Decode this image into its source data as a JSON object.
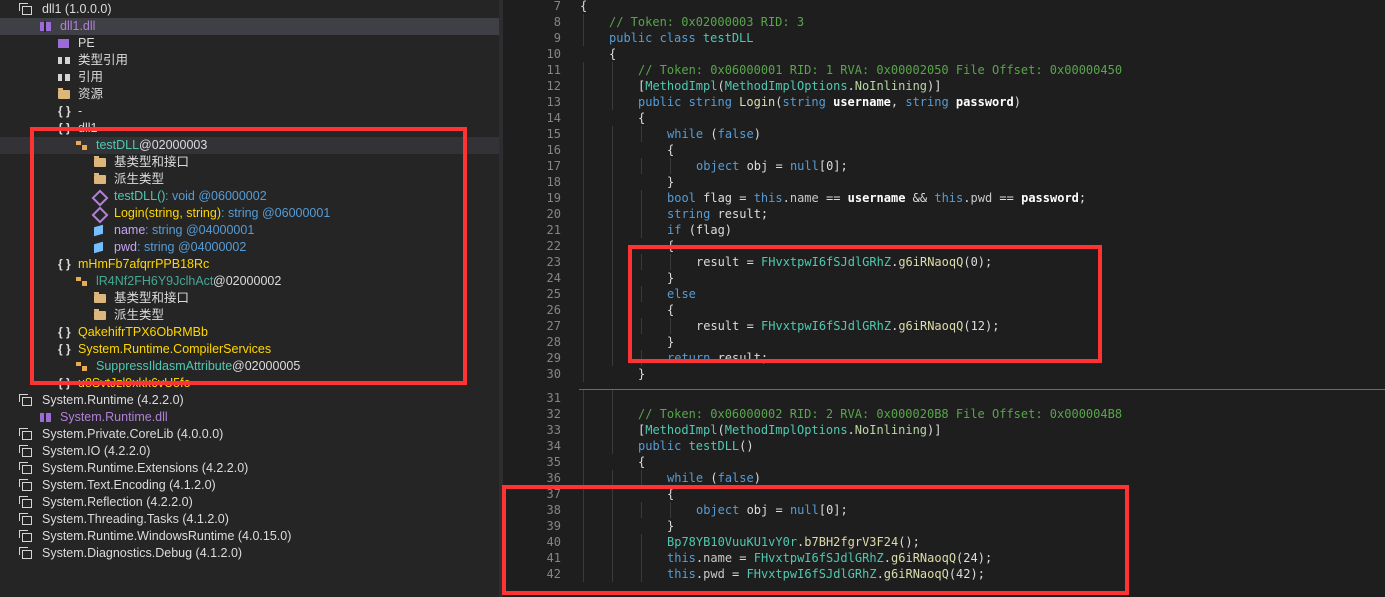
{
  "tree": {
    "rows": [
      {
        "indent": 0,
        "arrow": "◢",
        "icon": "asm",
        "icon_name": "assembly-icon",
        "text": "dll1 (1.0.0.0)",
        "cls": "c-gray",
        "sel": false
      },
      {
        "indent": 2,
        "arrow": "◢",
        "icon": "mod",
        "icon_name": "module-icon",
        "text": "dll1.dll",
        "cls": "c-lilac",
        "sel": "sel"
      },
      {
        "indent": 4,
        "arrow": "▷",
        "icon": "pe",
        "icon_name": "pe-icon",
        "text": "PE",
        "cls": "c-gray"
      },
      {
        "indent": 4,
        "arrow": "▷",
        "icon": "ref",
        "icon_name": "type-reference-icon",
        "text": "类型引用",
        "cls": "c-gray"
      },
      {
        "indent": 4,
        "arrow": "▷",
        "icon": "ref",
        "icon_name": "reference-icon",
        "text": "引用",
        "cls": "c-gray"
      },
      {
        "indent": 4,
        "arrow": "▷",
        "icon": "folder",
        "icon_name": "folder-icon",
        "text": "资源",
        "cls": "c-gray"
      },
      {
        "indent": 4,
        "arrow": "▷",
        "icon": "ns",
        "icon_name": "namespace-icon",
        "text": "-",
        "cls": "c-gray"
      },
      {
        "indent": 4,
        "arrow": "◢",
        "icon": "ns",
        "icon_name": "namespace-icon",
        "text": "dll1",
        "cls": "c-gray"
      },
      {
        "indent": 6,
        "arrow": "◢",
        "icon": "cls",
        "icon_name": "class-icon",
        "text": "testDLL",
        "suffix": " @02000003",
        "cls": "c-teal",
        "sel": "sel2"
      },
      {
        "indent": 8,
        "arrow": "▷",
        "icon": "folder",
        "icon_name": "folder-icon",
        "text": "基类型和接口",
        "cls": "c-gray"
      },
      {
        "indent": 8,
        "arrow": "",
        "icon": "folder",
        "icon_name": "folder-icon",
        "text": "派生类型",
        "cls": "c-gray"
      },
      {
        "indent": 8,
        "arrow": "",
        "icon": "meth",
        "icon_name": "method-icon",
        "text": "testDLL()",
        "suffix": " : void @06000002",
        "suffix_cls": "c-blue",
        "cls": "c-teal"
      },
      {
        "indent": 8,
        "arrow": "",
        "icon": "meth",
        "icon_name": "method-icon",
        "text": "Login(string, string)",
        "suffix": " : string @06000001",
        "suffix_cls": "c-blue",
        "cls": "c-yellow"
      },
      {
        "indent": 8,
        "arrow": "",
        "icon": "field",
        "icon_name": "field-icon",
        "text": "name",
        "suffix": " : string @04000001",
        "suffix_cls": "c-blue",
        "cls": "c-field"
      },
      {
        "indent": 8,
        "arrow": "",
        "icon": "field",
        "icon_name": "field-icon",
        "text": "pwd",
        "suffix": " : string @04000002",
        "suffix_cls": "c-blue",
        "cls": "c-field"
      },
      {
        "indent": 4,
        "arrow": "◢",
        "icon": "ns",
        "icon_name": "namespace-icon",
        "text": "mHmFb7afqrrPPB18Rc",
        "cls": "c-yellow"
      },
      {
        "indent": 6,
        "arrow": "◢",
        "icon": "cls",
        "icon_name": "class-icon",
        "text": "lR4Nf2FH6Y9JclhAct",
        "suffix": " @02000002",
        "cls": "c-dimteal"
      },
      {
        "indent": 8,
        "arrow": "▷",
        "icon": "folder",
        "icon_name": "folder-icon",
        "text": "基类型和接口",
        "cls": "c-gray"
      },
      {
        "indent": 8,
        "arrow": "",
        "icon": "folder",
        "icon_name": "folder-icon",
        "text": "派生类型",
        "cls": "c-gray"
      },
      {
        "indent": 4,
        "arrow": "▷",
        "icon": "ns",
        "icon_name": "namespace-icon",
        "text": "QakehifrTPX6ObRMBb",
        "cls": "c-yellow"
      },
      {
        "indent": 4,
        "arrow": "◢",
        "icon": "ns",
        "icon_name": "namespace-icon",
        "text": "System.Runtime.CompilerServices",
        "cls": "c-yellow"
      },
      {
        "indent": 6,
        "arrow": "▷",
        "icon": "cls",
        "icon_name": "class-icon",
        "text": "SuppressIldasmAttribute",
        "suffix": " @02000005",
        "cls": "c-teal"
      },
      {
        "indent": 4,
        "arrow": "▷",
        "icon": "ns",
        "icon_name": "namespace-icon",
        "text": "u8SvtJzl9xkk6vU5fo",
        "cls": "c-yellow"
      },
      {
        "indent": 0,
        "arrow": "◢",
        "icon": "asm",
        "icon_name": "assembly-icon",
        "text": "System.Runtime (4.2.2.0)",
        "cls": "c-gray"
      },
      {
        "indent": 2,
        "arrow": "▷",
        "icon": "mod",
        "icon_name": "module-icon",
        "text": "System.Runtime.dll",
        "cls": "c-lilac"
      },
      {
        "indent": 0,
        "arrow": "▷",
        "icon": "asm",
        "icon_name": "assembly-icon",
        "text": "System.Private.CoreLib (4.0.0.0)",
        "cls": "c-gray"
      },
      {
        "indent": 0,
        "arrow": "▷",
        "icon": "asm",
        "icon_name": "assembly-icon",
        "text": "System.IO (4.2.2.0)",
        "cls": "c-gray"
      },
      {
        "indent": 0,
        "arrow": "▷",
        "icon": "asm",
        "icon_name": "assembly-icon",
        "text": "System.Runtime.Extensions (4.2.2.0)",
        "cls": "c-gray"
      },
      {
        "indent": 0,
        "arrow": "▷",
        "icon": "asm",
        "icon_name": "assembly-icon",
        "text": "System.Text.Encoding (4.1.2.0)",
        "cls": "c-gray"
      },
      {
        "indent": 0,
        "arrow": "▷",
        "icon": "asm",
        "icon_name": "assembly-icon",
        "text": "System.Reflection (4.2.2.0)",
        "cls": "c-gray"
      },
      {
        "indent": 0,
        "arrow": "▷",
        "icon": "asm",
        "icon_name": "assembly-icon",
        "text": "System.Threading.Tasks (4.1.2.0)",
        "cls": "c-gray"
      },
      {
        "indent": 0,
        "arrow": "▷",
        "icon": "asm",
        "icon_name": "assembly-icon",
        "text": "System.Runtime.WindowsRuntime (4.0.15.0)",
        "cls": "c-gray"
      },
      {
        "indent": 0,
        "arrow": "▷",
        "icon": "asm",
        "icon_name": "assembly-icon",
        "text": "System.Diagnostics.Debug (4.1.2.0)",
        "cls": "c-gray"
      }
    ]
  },
  "code": {
    "lines": [
      {
        "n": "7",
        "depth": 0,
        "t": [
          [
            "",
            "{"
          ]
        ]
      },
      {
        "n": "8",
        "depth": 1,
        "t": [
          [
            "cm",
            "// Token: 0x02000003 RID: 3"
          ]
        ]
      },
      {
        "n": "9",
        "depth": 1,
        "t": [
          [
            "k",
            "public class "
          ],
          [
            "ty",
            "testDLL"
          ]
        ]
      },
      {
        "n": "10",
        "depth": 1,
        "t": [
          [
            "",
            "{"
          ]
        ]
      },
      {
        "n": "11",
        "depth": 2,
        "t": [
          [
            "cm",
            "// Token: 0x06000001 RID: 1 RVA: 0x00002050 File Offset: 0x00000450"
          ]
        ]
      },
      {
        "n": "12",
        "depth": 2,
        "t": [
          [
            "",
            "["
          ],
          [
            "ty",
            "MethodImpl"
          ],
          [
            "",
            "("
          ],
          [
            "ty",
            "MethodImplOptions"
          ],
          [
            "",
            "."
          ],
          [
            "en",
            "NoInlining"
          ],
          [
            "",
            ")]"
          ]
        ]
      },
      {
        "n": "13",
        "depth": 2,
        "t": [
          [
            "k",
            "public string "
          ],
          [
            "me",
            "Login"
          ],
          [
            "",
            "("
          ],
          [
            "k",
            "string "
          ],
          [
            "b",
            "username"
          ],
          [
            "",
            ", "
          ],
          [
            "k",
            "string "
          ],
          [
            "b",
            "password"
          ],
          [
            "",
            ")"
          ]
        ]
      },
      {
        "n": "14",
        "depth": 2,
        "t": [
          [
            "",
            "{"
          ]
        ]
      },
      {
        "n": "15",
        "depth": 3,
        "t": [
          [
            "k",
            "while "
          ],
          [
            "",
            "("
          ],
          [
            "k",
            "false"
          ],
          [
            "",
            ")"
          ]
        ]
      },
      {
        "n": "16",
        "depth": 3,
        "t": [
          [
            "",
            "{"
          ]
        ]
      },
      {
        "n": "17",
        "depth": 4,
        "t": [
          [
            "k",
            "object "
          ],
          [
            "",
            "obj = "
          ],
          [
            "k",
            "null"
          ],
          [
            "",
            "[0];"
          ]
        ]
      },
      {
        "n": "18",
        "depth": 3,
        "t": [
          [
            "",
            "}"
          ]
        ]
      },
      {
        "n": "19",
        "depth": 3,
        "t": [
          [
            "k",
            "bool "
          ],
          [
            "",
            "flag = "
          ],
          [
            "k",
            "this"
          ],
          [
            "",
            "."
          ],
          [
            "fld",
            "name"
          ],
          [
            "",
            " == "
          ],
          [
            "b",
            "username"
          ],
          [
            "",
            " && "
          ],
          [
            "k",
            "this"
          ],
          [
            "",
            "."
          ],
          [
            "fld",
            "pwd"
          ],
          [
            "",
            " == "
          ],
          [
            "b",
            "password"
          ],
          [
            "",
            ";"
          ]
        ]
      },
      {
        "n": "20",
        "depth": 3,
        "t": [
          [
            "k",
            "string "
          ],
          [
            "",
            "result;"
          ]
        ]
      },
      {
        "n": "21",
        "depth": 3,
        "t": [
          [
            "k",
            "if "
          ],
          [
            "",
            "(flag)"
          ]
        ]
      },
      {
        "n": "22",
        "depth": 3,
        "t": [
          [
            "",
            "{"
          ]
        ]
      },
      {
        "n": "23",
        "depth": 4,
        "t": [
          [
            "",
            "result = "
          ],
          [
            "ty",
            "FHvxtpwI6fSJdlGRhZ"
          ],
          [
            "",
            "."
          ],
          [
            "me",
            "g6iRNaoqQ"
          ],
          [
            "",
            "(0);"
          ]
        ]
      },
      {
        "n": "24",
        "depth": 3,
        "t": [
          [
            "",
            "}"
          ]
        ]
      },
      {
        "n": "25",
        "depth": 3,
        "t": [
          [
            "k",
            "else"
          ]
        ]
      },
      {
        "n": "26",
        "depth": 3,
        "t": [
          [
            "",
            "{"
          ]
        ]
      },
      {
        "n": "27",
        "depth": 4,
        "t": [
          [
            "",
            "result = "
          ],
          [
            "ty",
            "FHvxtpwI6fSJdlGRhZ"
          ],
          [
            "",
            "."
          ],
          [
            "me",
            "g6iRNaoqQ"
          ],
          [
            "",
            "(12);"
          ]
        ]
      },
      {
        "n": "28",
        "depth": 3,
        "t": [
          [
            "",
            "}"
          ]
        ]
      },
      {
        "n": "29",
        "depth": 3,
        "t": [
          [
            "k",
            "return "
          ],
          [
            "",
            "result;"
          ]
        ]
      },
      {
        "n": "30",
        "depth": 2,
        "t": [
          [
            "",
            "}"
          ]
        ]
      },
      {
        "n": "31",
        "depth": 2,
        "t": [
          [
            "",
            ""
          ]
        ]
      },
      {
        "n": "32",
        "depth": 2,
        "t": [
          [
            "cm",
            "// Token: 0x06000002 RID: 2 RVA: 0x000020B8 File Offset: 0x000004B8"
          ]
        ]
      },
      {
        "n": "33",
        "depth": 2,
        "t": [
          [
            "",
            "["
          ],
          [
            "ty",
            "MethodImpl"
          ],
          [
            "",
            "("
          ],
          [
            "ty",
            "MethodImplOptions"
          ],
          [
            "",
            "."
          ],
          [
            "en",
            "NoInlining"
          ],
          [
            "",
            ")]"
          ]
        ]
      },
      {
        "n": "34",
        "depth": 2,
        "t": [
          [
            "k",
            "public "
          ],
          [
            "ty",
            "testDLL"
          ],
          [
            "",
            "()"
          ]
        ]
      },
      {
        "n": "35",
        "depth": 2,
        "t": [
          [
            "",
            "{"
          ]
        ]
      },
      {
        "n": "36",
        "depth": 3,
        "t": [
          [
            "k",
            "while "
          ],
          [
            "",
            "("
          ],
          [
            "k",
            "false"
          ],
          [
            "",
            ")"
          ]
        ]
      },
      {
        "n": "37",
        "depth": 3,
        "t": [
          [
            "",
            "{"
          ]
        ]
      },
      {
        "n": "38",
        "depth": 4,
        "t": [
          [
            "k",
            "object "
          ],
          [
            "",
            "obj = "
          ],
          [
            "k",
            "null"
          ],
          [
            "",
            "[0];"
          ]
        ]
      },
      {
        "n": "39",
        "depth": 3,
        "t": [
          [
            "",
            "}"
          ]
        ]
      },
      {
        "n": "40",
        "depth": 3,
        "t": [
          [
            "ty",
            "Bp78YB10VuuKU1vY0r"
          ],
          [
            "",
            "."
          ],
          [
            "me",
            "b7BH2fgrV3F24"
          ],
          [
            "",
            "();"
          ]
        ]
      },
      {
        "n": "41",
        "depth": 3,
        "t": [
          [
            "k",
            "this"
          ],
          [
            "",
            "."
          ],
          [
            "fld",
            "name"
          ],
          [
            "",
            " = "
          ],
          [
            "ty",
            "FHvxtpwI6fSJdlGRhZ"
          ],
          [
            "",
            "."
          ],
          [
            "me",
            "g6iRNaoqQ"
          ],
          [
            "",
            "(24);"
          ]
        ]
      },
      {
        "n": "42",
        "depth": 3,
        "t": [
          [
            "k",
            "this"
          ],
          [
            "",
            "."
          ],
          [
            "fld",
            "pwd"
          ],
          [
            "",
            " = "
          ],
          [
            "ty",
            "FHvxtpwI6fSJdlGRhZ"
          ],
          [
            "",
            "."
          ],
          [
            "me",
            "g6iRNaoqQ"
          ],
          [
            "",
            "(42);"
          ]
        ]
      }
    ]
  },
  "colors": {
    "highlight_box": "#ff3333",
    "editor_bg": "#1e1e1e",
    "tree_bg": "#252526"
  }
}
